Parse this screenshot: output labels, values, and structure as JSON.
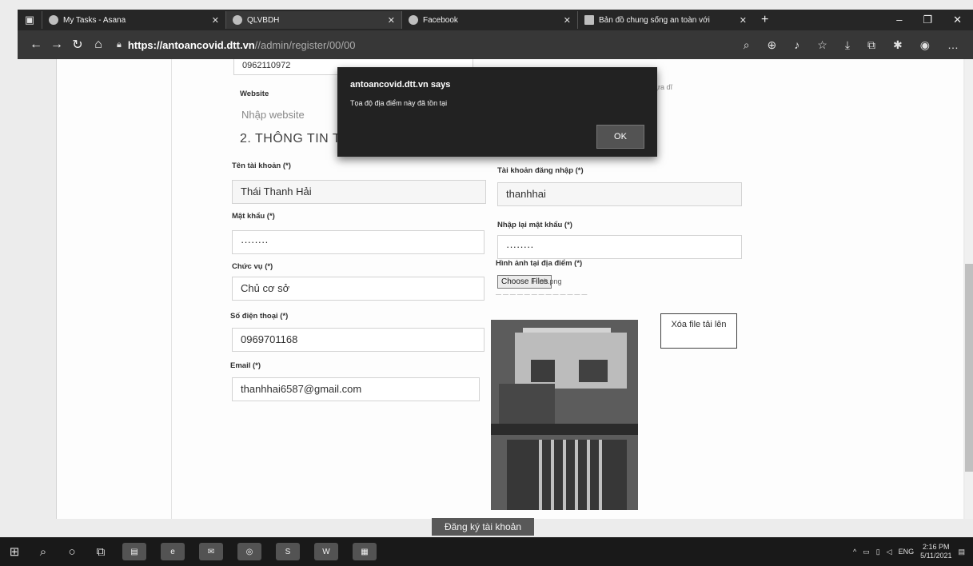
{
  "browser": {
    "tabs": [
      {
        "label": "My Tasks - Asana",
        "icon": "asana-icon"
      },
      {
        "label": "QLVBDH",
        "icon": "qlvbdh-icon"
      },
      {
        "label": "Facebook",
        "icon": "facebook-icon"
      },
      {
        "label": "Bản đồ chung sống an toàn với",
        "icon": "page-icon"
      }
    ],
    "url_host": "https://antoancovid.dtt.vn",
    "url_path": "//admin/register/00/00"
  },
  "form": {
    "phone_top_value": "0962110972",
    "website_label": "Website",
    "website_placeholder": "Nhập website",
    "section_title": "2. THÔNG TIN T",
    "account_name_label": "Tên tài khoản (*)",
    "account_name_value": "Thái Thanh Hải",
    "login_label": "Tài khoản đăng nhập (*)",
    "login_value": "thanhhai",
    "password_label": "Mật khẩu (*)",
    "password_value": "········",
    "confirm_label": "Nhập lại mật khẩu (*)",
    "confirm_value": "········",
    "position_label": "Chức vụ (*)",
    "position_value": "Chủ cơ sở",
    "image_label": "Hình ảnh tại địa điểm (*)",
    "choose_files": "Choose Files",
    "file_name": "Hình.png",
    "phone_label": "Số điện thoại (*)",
    "phone_value": "0969701168",
    "email_label": "Email (*)",
    "email_value": "thanhhai6587@gmail.com",
    "remove_file": "Xóa file tải lên",
    "submit": "Đăng ký tài khoản"
  },
  "dialog": {
    "title": "antoancovid.dtt.vn says",
    "message": "Tọa độ địa điểm này đã tồn tại",
    "ok": "OK"
  },
  "taskbar": {
    "lang": "ENG",
    "time": "2:16 PM",
    "date": "5/11/2021"
  }
}
